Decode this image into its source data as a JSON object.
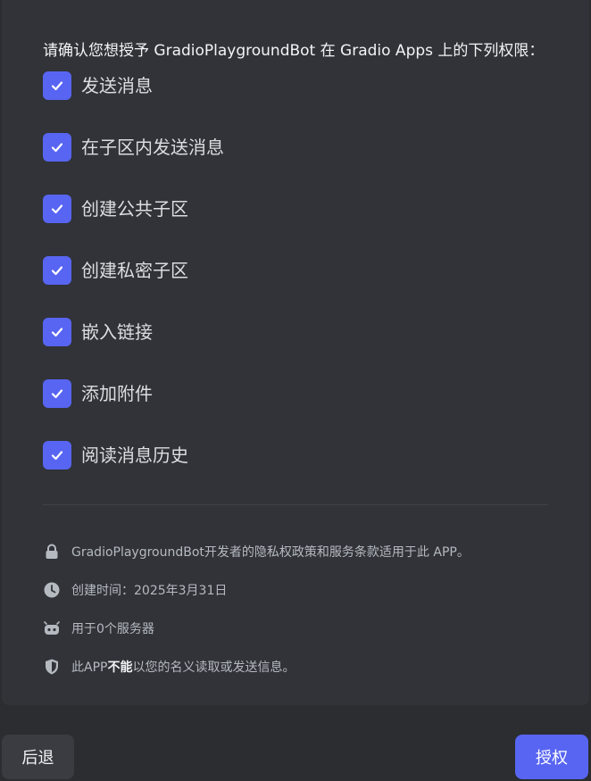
{
  "heading": "请确认您想授予 GradioPlaygroundBot 在 Gradio Apps 上的下列权限：",
  "permissions": [
    {
      "label": "发送消息",
      "checked": true
    },
    {
      "label": "在子区内发送消息",
      "checked": true
    },
    {
      "label": "创建公共子区",
      "checked": true
    },
    {
      "label": "创建私密子区",
      "checked": true
    },
    {
      "label": "嵌入链接",
      "checked": true
    },
    {
      "label": "添加附件",
      "checked": true
    },
    {
      "label": "阅读消息历史",
      "checked": true
    }
  ],
  "info": {
    "privacy": {
      "icon": "lock-icon",
      "text": "GradioPlaygroundBot开发者的隐私权政策和服务条款适用于此 APP。"
    },
    "created": {
      "icon": "clock-icon",
      "text": "创建时间：2025年3月31日"
    },
    "servers": {
      "icon": "bot-icon",
      "text": "用于0个服务器"
    },
    "safety": {
      "icon": "shield-icon",
      "prefix": "此APP",
      "bold": "不能",
      "suffix": "以您的名义读取或发送信息。"
    }
  },
  "buttons": {
    "back": "后退",
    "authorize": "授权"
  },
  "colors": {
    "accent": "#5865f2",
    "background": "#2b2d31",
    "card": "#313338"
  }
}
